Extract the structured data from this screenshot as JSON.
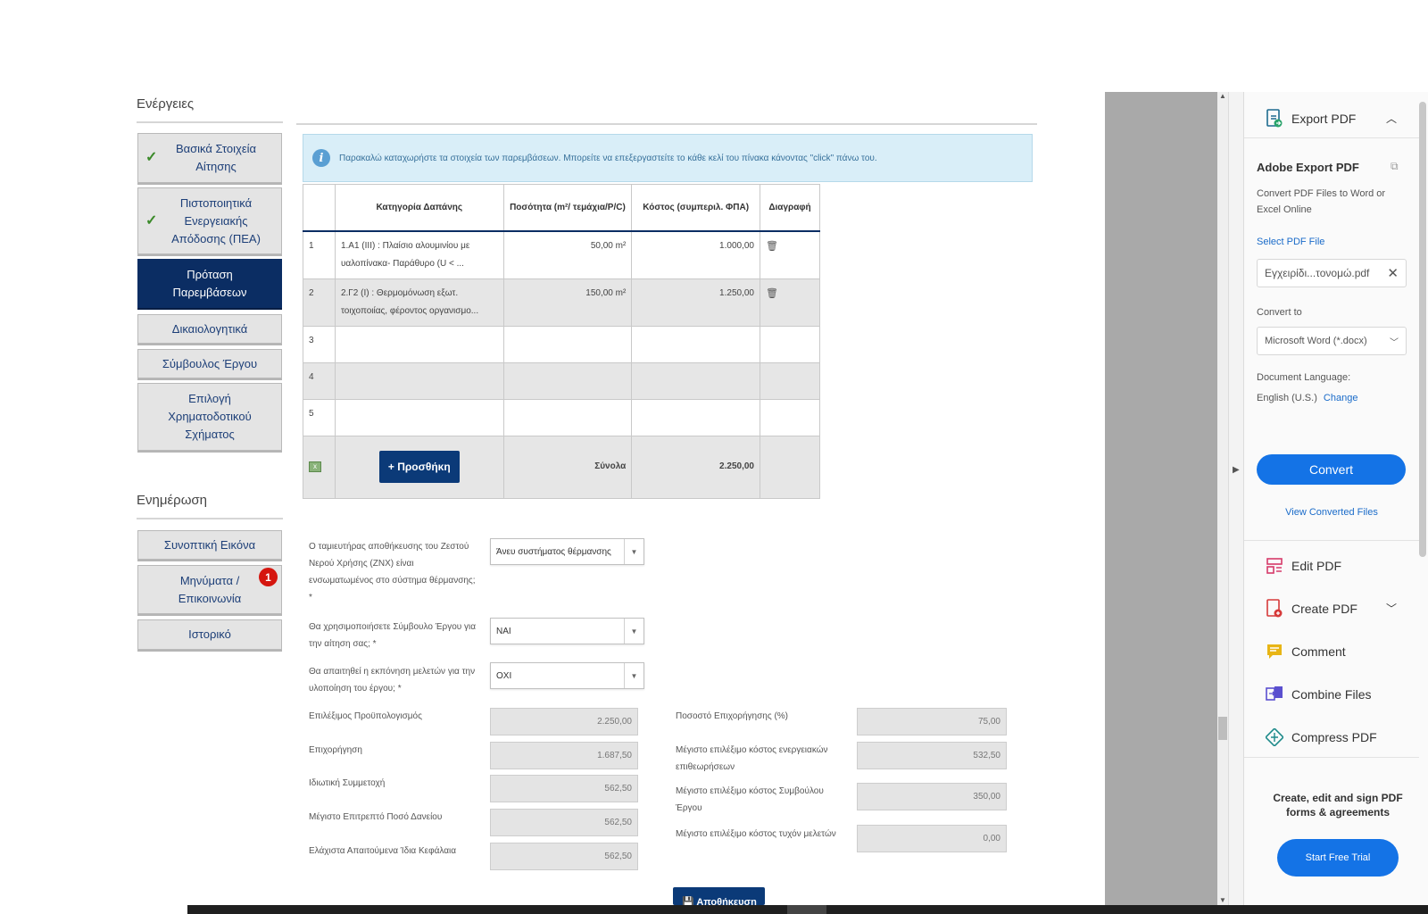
{
  "nav": {
    "actions_heading": "Ενέργειες",
    "items": [
      {
        "label": "Βασικά Στοιχεία Αίτησης",
        "done": true
      },
      {
        "label": "Πιστοποιητικά Ενεργειακής Απόδοσης (ΠΕΑ)",
        "done": true
      },
      {
        "label": "Πρόταση Παρεμβάσεων",
        "active": true
      },
      {
        "label": "Δικαιολογητικά"
      },
      {
        "label": "Σύμβουλος Έργου"
      },
      {
        "label": "Επιλογή Χρηματοδοτικού Σχήματος"
      }
    ],
    "updates_heading": "Ενημέρωση",
    "updates": [
      {
        "label": "Συνοπτική Εικόνα"
      },
      {
        "label": "Μηνύματα / Επικοινωνία",
        "badge": "1"
      },
      {
        "label": "Ιστορικό"
      }
    ]
  },
  "info_banner": "Παρακαλώ καταχωρήστε τα στοιχεία των παρεμβάσεων. Μπορείτε να επεξεργαστείτε το κάθε κελί του πίνακα κάνοντας \"click\" πάνω του.",
  "grid": {
    "headers": [
      "Κατηγορία Δαπάνης",
      "Ποσότητα (m²/ τεμάχια/P/C)",
      "Κόστος (συμπεριλ. ΦΠΑ)",
      "Διαγραφή"
    ],
    "rows": [
      {
        "n": "1",
        "category": "1.Α1 (ΙΙΙ) : Πλαίσιο αλουμινίου με υαλοπίνακα- Παράθυρο (U < ...",
        "qty": "50,00 m²",
        "cost": "1.000,00",
        "del": "🗑"
      },
      {
        "n": "2",
        "category": "2.Γ2 (Ι) : Θερμομόνωση εξωτ. τοιχοποιίας, φέροντος οργανισμο...",
        "qty": "150,00 m²",
        "cost": "1.250,00",
        "del": "🗑"
      },
      {
        "n": "3",
        "category": "",
        "qty": "",
        "cost": "",
        "del": ""
      },
      {
        "n": "4",
        "category": "",
        "qty": "",
        "cost": "",
        "del": ""
      },
      {
        "n": "5",
        "category": "",
        "qty": "",
        "cost": "",
        "del": ""
      }
    ],
    "add_label": "+ Προσθήκη",
    "totals_label": "Σύνολα",
    "totals_value": "2.250,00"
  },
  "form": {
    "q1_label": "Ο ταμιευτήρας αποθήκευσης του Ζεστού Νερού Χρήσης (ΖΝΧ) είναι ενσωματωμένος στο σύστημα θέρμανσης; *",
    "q1_value": "Άνευ συστήματος θέρμανσης",
    "q2_label": "Θα χρησιμοποιήσετε Σύμβουλο Έργου για την αίτηση σας; *",
    "q2_value": "ΝΑΙ",
    "q3_label": "Θα απαιτηθεί η εκπόνηση μελετών για την υλοποίηση του έργου; *",
    "q3_value": "ΟΧΙ",
    "left_fields": [
      {
        "label": "Επιλέξιμος Προϋπολογισμός",
        "value": "2.250,00"
      },
      {
        "label": "Επιχορήγηση",
        "value": "1.687,50"
      },
      {
        "label": "Ιδιωτική Συμμετοχή",
        "value": "562,50"
      },
      {
        "label": "Μέγιστο Επιτρεπτό Ποσό Δανείου",
        "value": "562,50"
      },
      {
        "label": "Ελάχιστα Απαιτούμενα Ίδια Κεφάλαια",
        "value": "562,50"
      }
    ],
    "right_fields": [
      {
        "label": "Ποσοστό Επιχορήγησης (%)",
        "value": "75,00"
      },
      {
        "label": "Μέγιστο επιλέξιμο κόστος ενεργειακών επιθεωρήσεων",
        "value": "532,50"
      },
      {
        "label": "Μέγιστο επιλέξιμο κόστος Συμβούλου Έργου",
        "value": "350,00"
      },
      {
        "label": "Μέγιστο επιλέξιμο κόστος τυχόν μελετών",
        "value": "0,00"
      }
    ],
    "save_label": "💾 Αποθήκευση"
  },
  "panel": {
    "export_title": "Export PDF",
    "adobe_title": "Adobe Export PDF",
    "adobe_desc": "Convert PDF Files to Word or Excel Online",
    "select_label": "Select PDF File",
    "file_name": "Εγχειρίδι...τονομώ.pdf",
    "convert_to_label": "Convert to",
    "convert_to_value": "Microsoft Word (*.docx)",
    "doc_lang_label": "Document Language:",
    "doc_lang_value": "English (U.S.)",
    "change_label": "Change",
    "convert_button": "Convert",
    "view_converted": "View Converted Files",
    "tools": [
      "Edit PDF",
      "Create PDF",
      "Comment",
      "Combine Files",
      "Compress PDF"
    ],
    "promo": "Create, edit and sign PDF forms & agreements",
    "trial_button": "Start Free Trial"
  },
  "colors": {
    "nav_active": "#0b2d63",
    "adobe_blue": "#1473e6",
    "badge_red": "#d5160f"
  }
}
